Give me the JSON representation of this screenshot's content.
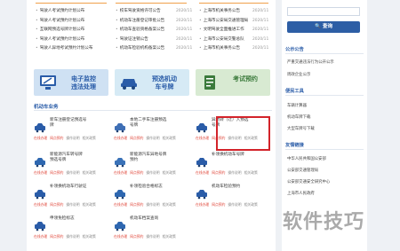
{
  "news": {
    "left": [
      {
        "title": "驾驶人考试预约计划公布",
        "date": ""
      },
      {
        "title": "驾驶人考试预约计划公布",
        "date": ""
      },
      {
        "title": "互联网预选号牌计划公布",
        "date": ""
      },
      {
        "title": "驾驶人考试预约计划公布",
        "date": ""
      },
      {
        "title": "驾驶人异地考试预约计划公布",
        "date": ""
      }
    ],
    "mid": [
      {
        "title": "校车驾驶资格许可公告",
        "date": "2020/11"
      },
      {
        "title": "机动车注册登记审批公告",
        "date": "2020/11"
      },
      {
        "title": "机动车查验资格备案公告",
        "date": "2020/11"
      },
      {
        "title": "驾驶证注销公告",
        "date": "2020/11"
      },
      {
        "title": "机动车检验机构备案公告",
        "date": "2020/11"
      }
    ],
    "right": [
      {
        "title": "上海市机关事务公告",
        "date": "2020/11"
      },
      {
        "title": "上海市公安局交通管理局",
        "date": "2020/11"
      },
      {
        "title": "文明驾驶全面推进工作",
        "date": "2020/11"
      },
      {
        "title": "上海市公安局交警总队",
        "date": "2020/11"
      },
      {
        "title": "上海市机关事务公告",
        "date": "2020/11"
      }
    ]
  },
  "banners": [
    {
      "label": "电子监控\n违法处理",
      "bg": "#cfe1f3",
      "color": "#2a5ca8"
    },
    {
      "label": "预选机动\n车号牌",
      "bg": "#d6eaf5",
      "color": "#2a5ca8"
    },
    {
      "label": "考试预约",
      "bg": "#d8ead2",
      "color": "#3b7a3b"
    }
  ],
  "section": {
    "title": "机动车业务"
  },
  "services": [
    {
      "name": "新车注册登记预选号\n牌",
      "links": [
        "在线办理",
        "网点预约",
        "操作说明",
        "相关政策"
      ]
    },
    {
      "name": "本地二手车注册预选\n号牌",
      "links": [
        "在线办理",
        "网点预约",
        "操作说明",
        "相关政策"
      ]
    },
    {
      "name": "异地转（迁）入预选\n号牌",
      "links": [
        "在线办理",
        "网点预约",
        "操作说明",
        "相关政策"
      ]
    },
    {
      "name": "新能源汽车转号牌\n预选号牌",
      "links": [
        "在线办理",
        "网点预约",
        "操作说明",
        "相关政策"
      ]
    },
    {
      "name": "新能源汽车异地号牌\n预约",
      "links": [
        "在线办理",
        "网点预约",
        "操作说明",
        "相关政策"
      ]
    },
    {
      "name": "补领换机动车号牌",
      "links": [
        "在线办理",
        "网点预约",
        "操作说明",
        "相关政策"
      ]
    },
    {
      "name": "补领换机动车行驶证",
      "links": [
        "在线办理",
        "网点预约",
        "操作说明",
        "相关政策"
      ]
    },
    {
      "name": "补领检验合格标志",
      "links": [
        "在线办理",
        "网点预约",
        "操作说明",
        "相关政策"
      ]
    },
    {
      "name": "机动车检验预约",
      "links": [
        "在线办理",
        "网点预约",
        "操作说明",
        "相关政策"
      ]
    },
    {
      "name": "申领免检标志",
      "links": [
        "在线办理",
        "网点预约",
        "操作说明",
        "相关政策"
      ]
    },
    {
      "name": "机动车档案查询",
      "links": [
        "在线办理",
        "网点预约",
        "操作说明",
        "相关政策"
      ]
    }
  ],
  "sidebar": {
    "search_label": "查询",
    "notice_title": "公示公告",
    "notice_items": [
      "严重交通违法行为公开公示",
      "周政企业公示"
    ],
    "tools_title": "便民工具",
    "tools_items": [
      "车辆计算器",
      "机动车牌下载",
      "大型车牌号下载"
    ],
    "links_title": "友情链接",
    "links_items": [
      "中华人民共和国公安部",
      "公安部交通管理局",
      "公安部交通安全研究中心",
      "上海市人民政府"
    ]
  },
  "watermark": "软件技巧"
}
